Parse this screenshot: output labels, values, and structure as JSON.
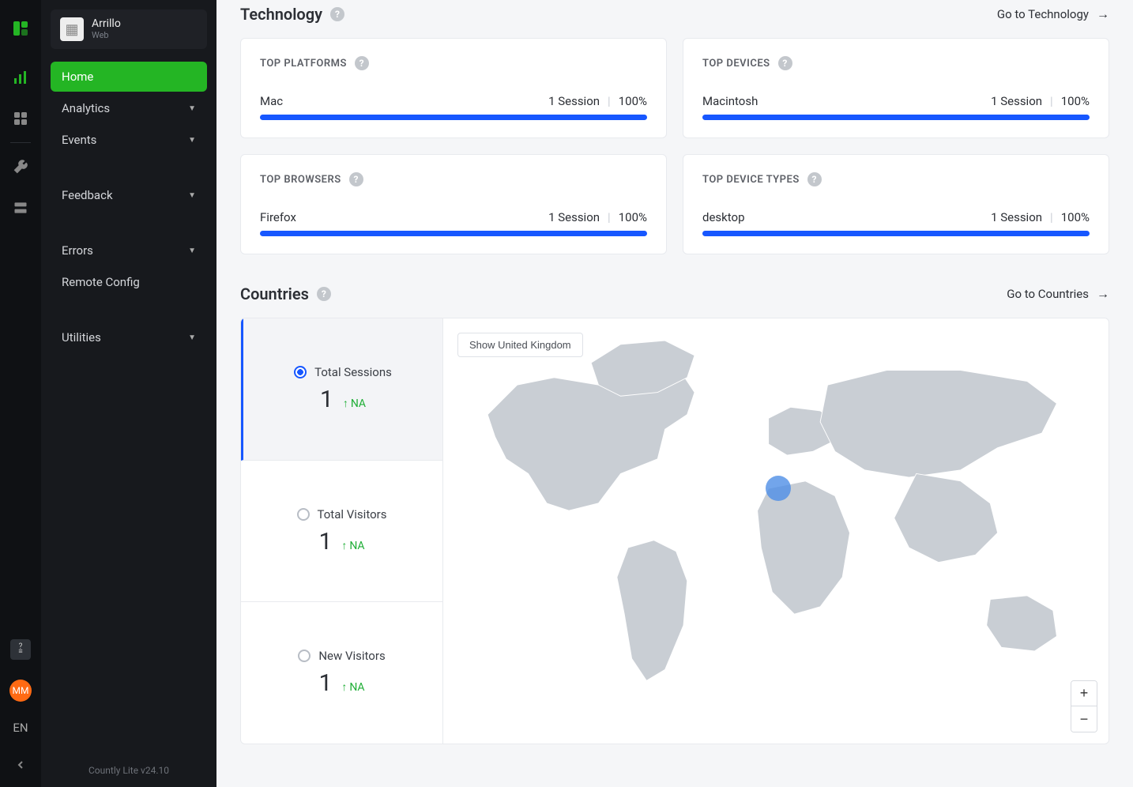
{
  "app": {
    "name": "Arrillo",
    "platform": "Web"
  },
  "nav": {
    "home": "Home",
    "analytics": "Analytics",
    "events": "Events",
    "feedback": "Feedback",
    "errors": "Errors",
    "remote_config": "Remote Config",
    "utilities": "Utilities"
  },
  "footer": {
    "version": "Countly Lite v24.10"
  },
  "rail": {
    "lang": "EN",
    "avatar": "MM"
  },
  "technology": {
    "title": "Technology",
    "go_link": "Go to Technology",
    "cards": {
      "platforms": {
        "title": "TOP PLATFORMS",
        "name": "Mac",
        "sessions": "1 Session",
        "percent": "100%",
        "fill": 100
      },
      "devices": {
        "title": "TOP DEVICES",
        "name": "Macintosh",
        "sessions": "1 Session",
        "percent": "100%",
        "fill": 100
      },
      "browsers": {
        "title": "TOP BROWSERS",
        "name": "Firefox",
        "sessions": "1 Session",
        "percent": "100%",
        "fill": 100
      },
      "device_types": {
        "title": "TOP DEVICE TYPES",
        "name": "desktop",
        "sessions": "1 Session",
        "percent": "100%",
        "fill": 100
      }
    }
  },
  "countries": {
    "title": "Countries",
    "go_link": "Go to Countries",
    "show_button": "Show United Kingdom",
    "metrics": [
      {
        "label": "Total Sessions",
        "value": "1",
        "delta": "NA",
        "active": true
      },
      {
        "label": "Total Visitors",
        "value": "1",
        "delta": "NA",
        "active": false
      },
      {
        "label": "New Visitors",
        "value": "1",
        "delta": "NA",
        "active": false
      }
    ]
  }
}
